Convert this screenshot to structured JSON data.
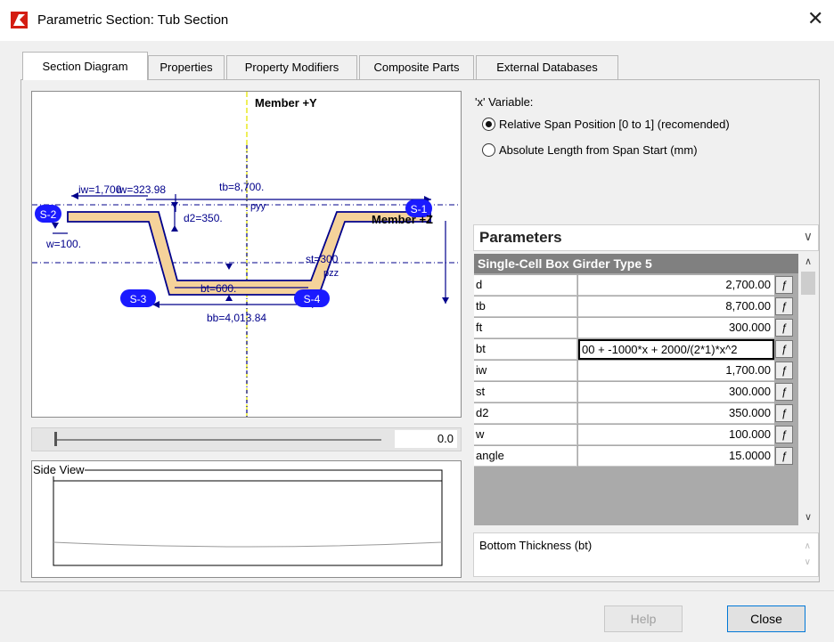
{
  "window": {
    "title": "Parametric Section: Tub Section"
  },
  "tabs": [
    "Section Diagram",
    "Properties",
    "Property Modifiers",
    "Composite Parts",
    "External Databases"
  ],
  "diagram": {
    "member_y_label": "Member +Y",
    "member_z_label": "Member +Z",
    "labels": {
      "iw": "iw=1,700",
      "iw2": "iw=323.98",
      "tb": "tb=8,700.",
      "d2": "d2=350.",
      "w": "w=100.",
      "pyy": "pyy",
      "st": "st=300",
      "pzz": "pzz",
      "bt": "bt=600.",
      "bb": "bb=4,013.84"
    },
    "stations": [
      "S-2",
      "S-1",
      "S-3",
      "S-4"
    ]
  },
  "slider": {
    "value": "0.0"
  },
  "side_view": {
    "label": "Side View"
  },
  "variable": {
    "label": "'x' Variable:",
    "options": [
      {
        "label": "Relative Span Position [0 to 1] (recomended)",
        "selected": true
      },
      {
        "label": "Absolute Length from Span Start (mm)",
        "selected": false
      }
    ]
  },
  "parameters": {
    "title": "Parameters",
    "section_name": "Single-Cell Box Girder Type 5",
    "rows": [
      {
        "name": "d",
        "value": "2,700.00"
      },
      {
        "name": "tb",
        "value": "8,700.00"
      },
      {
        "name": "ft",
        "value": "300.000"
      },
      {
        "name": "bt",
        "value": "00 + -1000*x + 2000/(2*1)*x^2"
      },
      {
        "name": "iw",
        "value": "1,700.00"
      },
      {
        "name": "st",
        "value": "300.000"
      },
      {
        "name": "d2",
        "value": "350.000"
      },
      {
        "name": "w",
        "value": "100.000"
      },
      {
        "name": "angle",
        "value": "15.0000"
      }
    ],
    "formula_button_glyph": "ƒ",
    "editing_row": 3,
    "description": "Bottom Thickness (bt)"
  },
  "buttons": {
    "help": "Help",
    "close": "Close"
  },
  "colors": {
    "section_fill": "#f5d29a",
    "dim_blue": "#00008b",
    "station_blue": "#1a1aff",
    "axis_yellow": "#e6e600"
  },
  "icons": {
    "close": "close-icon",
    "app": "app-logo-icon",
    "formula": "function-icon"
  }
}
